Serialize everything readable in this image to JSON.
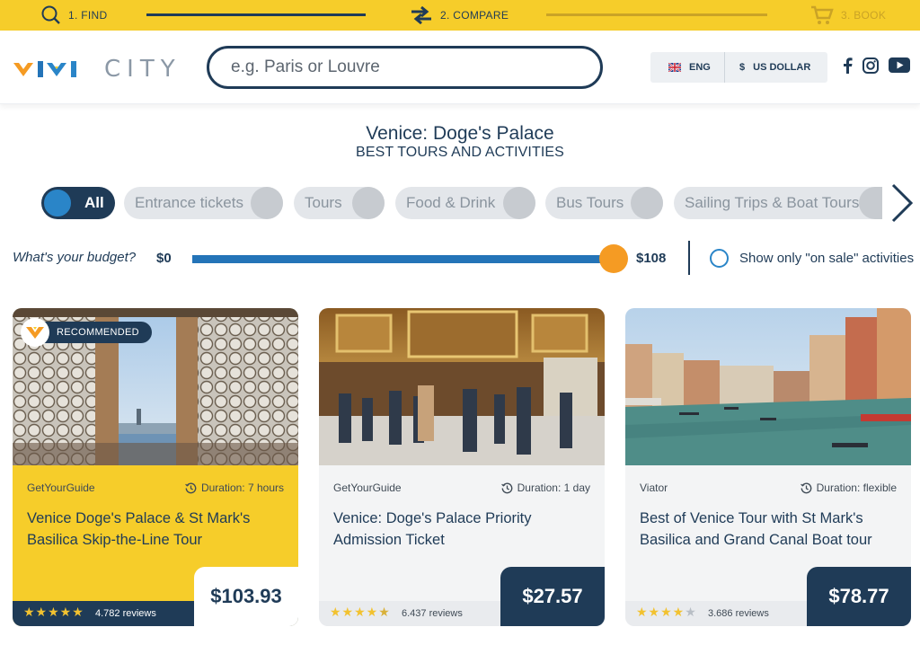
{
  "steps": [
    {
      "label": "1. FIND",
      "icon": "search-icon"
    },
    {
      "label": "2. COMPARE",
      "icon": "compare-arrows-icon"
    },
    {
      "label": "3. BOOK",
      "icon": "cart-icon"
    }
  ],
  "brand": {
    "name": "CITY"
  },
  "search": {
    "placeholder": "e.g. Paris or Louvre"
  },
  "locale": {
    "language": "ENG",
    "currency_symbol": "$",
    "currency": "US DOLLAR"
  },
  "social": [
    "facebook-icon",
    "instagram-icon",
    "youtube-icon"
  ],
  "page": {
    "title": "Venice: Doge's Palace",
    "subtitle": "BEST TOURS AND ACTIVITIES"
  },
  "categories": [
    {
      "label": "All",
      "active": true
    },
    {
      "label": "Entrance tickets",
      "active": false
    },
    {
      "label": "Tours",
      "active": false
    },
    {
      "label": "Food & Drink",
      "active": false
    },
    {
      "label": "Bus Tours",
      "active": false
    },
    {
      "label": "Sailing Trips & Boat Tours",
      "active": false
    }
  ],
  "budget": {
    "label": "What's your budget?",
    "min": "$0",
    "max": "$108",
    "sale_label": "Show only \"on sale\" activities"
  },
  "cards": [
    {
      "badge": "RECOMMENDED",
      "provider": "GetYourGuide",
      "duration": "Duration: 7 hours",
      "title": "Venice Doge's Palace & St Mark's Basilica Skip-the-Line Tour",
      "price": "$103.93",
      "rating": 5,
      "reviews": "4.782 reviews"
    },
    {
      "provider": "GetYourGuide",
      "duration": "Duration: 1 day",
      "title": "Venice: Doge's Palace Priority Admission Ticket",
      "price": "$27.57",
      "rating": 4.5,
      "reviews": "6.437 reviews"
    },
    {
      "provider": "Viator",
      "duration": "Duration: flexible",
      "title": "Best of Venice Tour with St Mark's Basilica and Grand Canal Boat tour",
      "price": "$78.77",
      "rating": 4,
      "reviews": "3.686 reviews"
    }
  ],
  "colors": {
    "yellow": "#f6cd2a",
    "navy": "#1f3b57",
    "blue": "#2474b8",
    "orange": "#f59b23"
  }
}
